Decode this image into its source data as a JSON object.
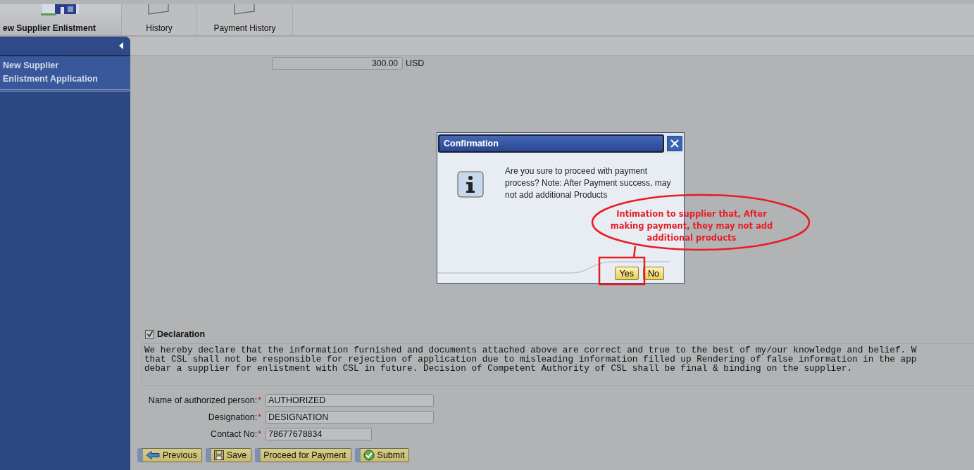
{
  "nav_tabs": [
    {
      "label": "ew Supplier Enlistment",
      "selected": true,
      "kind": "building"
    },
    {
      "label": "History",
      "selected": false,
      "kind": "document"
    },
    {
      "label": "Payment History",
      "selected": false,
      "kind": "document"
    }
  ],
  "sidebar": {
    "items": [
      {
        "lines": [
          "New Supplier",
          "Enlistment Application"
        ],
        "selected": true
      }
    ]
  },
  "amount": {
    "value": "300.00",
    "currency": "USD"
  },
  "declaration": {
    "label": "Declaration",
    "checked": true,
    "lines": [
      "We hereby declare that the information furnished and documents attached above are correct and true to the best of my/our knowledge and belief. W",
      "that CSL shall not be responsible for rejection of application due to misleading information filled up Rendering of false information in the app",
      "debar a supplier for enlistment with CSL in future. Decision of Competent Authority of CSL shall be final & binding on the supplier."
    ]
  },
  "fields": [
    {
      "label": "Name of authorized person:",
      "marker": "*",
      "value": "AUTHORIZED",
      "kind": "wide"
    },
    {
      "label": "Designation:",
      "marker": "*",
      "value": "DESIGNATION",
      "kind": "wide"
    },
    {
      "label": "Contact No:",
      "marker": "*",
      "value": "78677678834",
      "kind": "short"
    }
  ],
  "buttons": [
    {
      "label": "Previous",
      "kind": "previous"
    },
    {
      "label": "Save",
      "kind": "save"
    },
    {
      "label": "Proceed for Payment",
      "kind": "plain"
    },
    {
      "label": "Submit",
      "kind": "submit"
    }
  ],
  "dialog": {
    "title": "Confirmation",
    "message": "Are you sure to proceed with payment process? Note: After Payment success, may not add additional Products",
    "buttons": [
      {
        "label": "Yes"
      },
      {
        "label": "No"
      }
    ]
  },
  "annotation": {
    "text": "Intimation to supplier that, After making payment, they may not add additional products"
  }
}
